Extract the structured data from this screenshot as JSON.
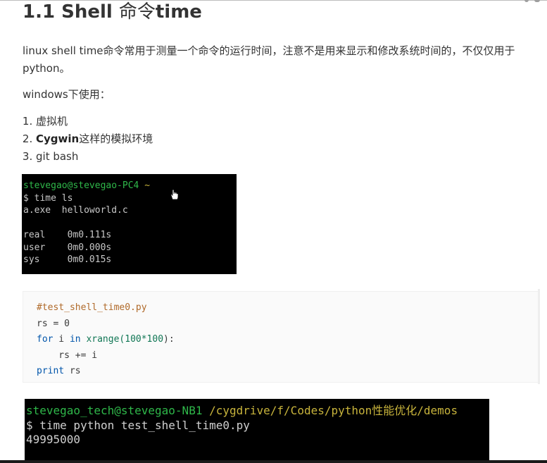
{
  "heading": {
    "prefix": "1.1 Shell ",
    "cjk": "命令",
    "suffix": "time"
  },
  "intro_paragraph": "linux shell  time命令常用于测量一个命令的运行时间，注意不是用来显示和修改系统时间的，不仅仅用于python。",
  "windows_label": "windows下使用：",
  "usage_list": [
    {
      "bold": "",
      "text": "虚拟机"
    },
    {
      "bold": "Cygwin",
      "text": "这样的模拟环境"
    },
    {
      "bold": "",
      "text": "git bash"
    }
  ],
  "terminal1": {
    "prompt_user": "stevegao@stevegao-PC4",
    "prompt_dir": "~",
    "command": "$ time ls",
    "output": "a.exe  helloworld.c",
    "timings": [
      {
        "label": "real",
        "value": "0m0.111s"
      },
      {
        "label": "user",
        "value": "0m0.000s"
      },
      {
        "label": "sys",
        "value": "0m0.015s"
      }
    ]
  },
  "code_block": {
    "comment": "#test_shell_time0.py",
    "line2": "rs = 0",
    "line3_kw1": "for",
    "line3_mid": " i ",
    "line3_kw2": "in",
    "line3_fn": " xrange(",
    "line3_num": "100*100",
    "line3_end": "):",
    "line4": "    rs += i",
    "line5_kw": "print",
    "line5_rest": " rs"
  },
  "terminal2": {
    "prompt_user": "stevegao_tech@stevegao-NB1",
    "prompt_path": " /cygdrive/f/Codes/python性能优化/demos",
    "command": "$ time python test_shell_time0.py",
    "output": "49995000"
  },
  "colors": {
    "terminal_bg": "#000000",
    "prompt_green": "#2fb84a",
    "path_yellow": "#c8b43c",
    "code_comment": "#b06a2a",
    "code_keyword": "#0055aa"
  }
}
